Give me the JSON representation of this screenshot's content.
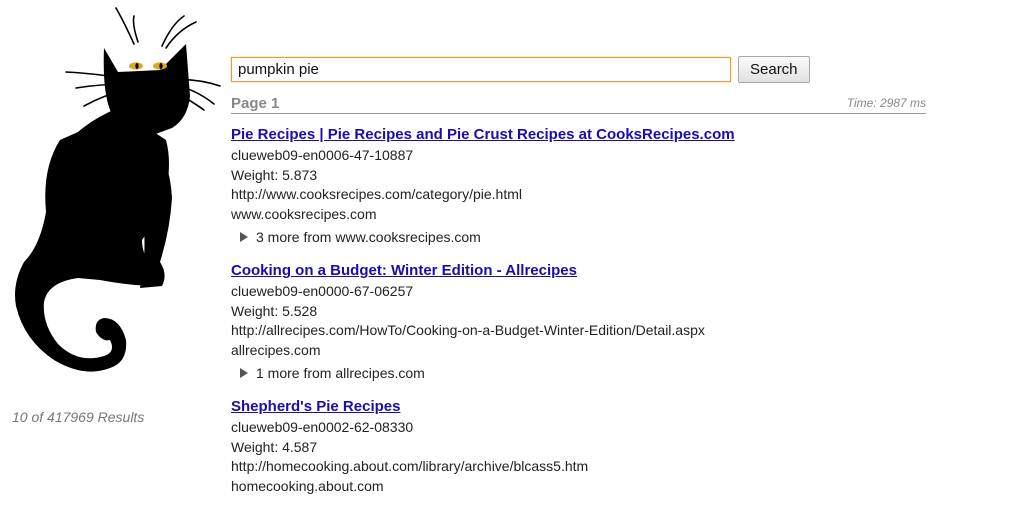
{
  "search": {
    "query": "pumpkin pie",
    "button_label": "Search"
  },
  "header": {
    "page_label": "Page 1",
    "time_label": "Time: 2987 ms"
  },
  "sidebar": {
    "result_count": "10 of 417969 Results",
    "logo_icon": "black-cat-logo"
  },
  "results": [
    {
      "title": "Pie Recipes | Pie Recipes and Pie Crust Recipes at CooksRecipes.com",
      "doc_id": "clueweb09-en0006-47-10887",
      "weight": "Weight: 5.873",
      "url": "http://www.cooksrecipes.com/category/pie.html",
      "domain": "www.cooksrecipes.com",
      "more": "3 more from www.cooksrecipes.com"
    },
    {
      "title": "Cooking on a Budget: Winter Edition - Allrecipes",
      "doc_id": "clueweb09-en0000-67-06257",
      "weight": "Weight: 5.528",
      "url": "http://allrecipes.com/HowTo/Cooking-on-a-Budget-Winter-Edition/Detail.aspx",
      "domain": "allrecipes.com",
      "more": "1 more from allrecipes.com"
    },
    {
      "title": "Shepherd's Pie Recipes",
      "doc_id": "clueweb09-en0002-62-08330",
      "weight": "Weight: 4.587",
      "url": "http://homecooking.about.com/library/archive/blcass5.htm",
      "domain": "homecooking.about.com"
    }
  ]
}
